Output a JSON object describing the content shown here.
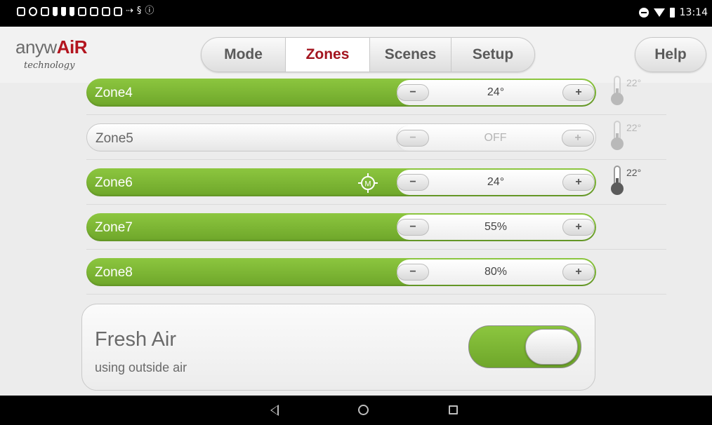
{
  "status_bar": {
    "time": "13:14"
  },
  "header": {
    "logo_prefix": "anyw",
    "logo_accent": "AiR",
    "logo_sub": "technology",
    "tabs": [
      {
        "label": "Mode",
        "active": false
      },
      {
        "label": "Zones",
        "active": true
      },
      {
        "label": "Scenes",
        "active": false
      },
      {
        "label": "Setup",
        "active": false
      }
    ],
    "help_label": "Help"
  },
  "zones": [
    {
      "name": "Zone4",
      "value": "24°",
      "state": "on",
      "thermometer_temp": "22°",
      "thermometer_faded": true
    },
    {
      "name": "Zone5",
      "value": "OFF",
      "state": "off",
      "thermometer_temp": "22°",
      "thermometer_faded": true
    },
    {
      "name": "Zone6",
      "value": "24°",
      "state": "on",
      "marker": "M",
      "thermometer_temp": "22°",
      "thermometer_faded": false
    },
    {
      "name": "Zone7",
      "value": "55%",
      "state": "on"
    },
    {
      "name": "Zone8",
      "value": "80%",
      "state": "on"
    }
  ],
  "controls": {
    "minus_label": "−",
    "plus_label": "+"
  },
  "fresh_air": {
    "title": "Fresh Air",
    "subtitle": "using outside air",
    "enabled": true
  },
  "colors": {
    "accent_green": "#7bb534",
    "active_tab_red": "#a3151f"
  }
}
